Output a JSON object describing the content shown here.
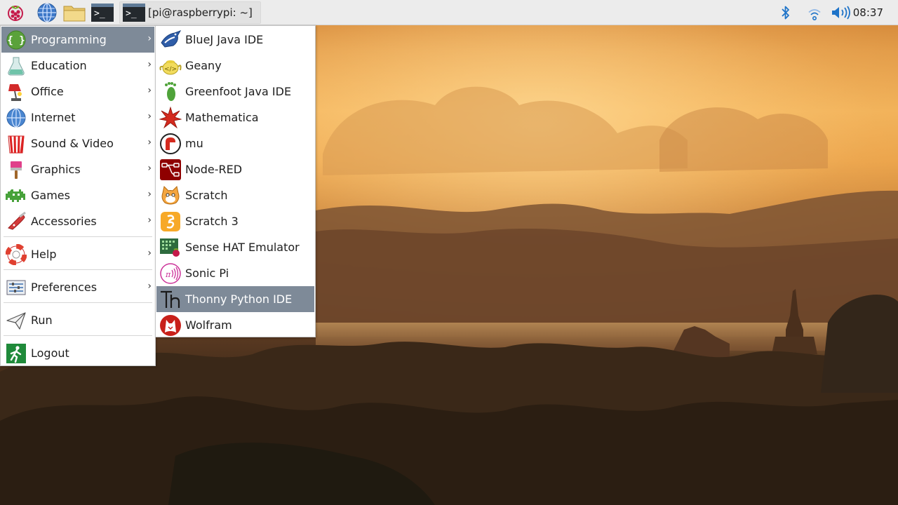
{
  "colors": {
    "taskbar_bg": "#ececec",
    "menu_bg": "#ffffff",
    "menu_selected_bg": "#7e8a98",
    "menu_selected_text": "#ffffff",
    "status_icon_blue": "#1e73c8"
  },
  "taskbar": {
    "launchers": [
      {
        "icon": "raspberry-pi-menu-icon"
      },
      {
        "icon": "web-browser-icon"
      },
      {
        "icon": "file-manager-icon"
      },
      {
        "icon": "terminal-icon"
      }
    ],
    "window_button": {
      "icon": "terminal-icon",
      "label": "[pi@raspberrypi: ~]"
    },
    "tray": {
      "bluetooth_icon": "bluetooth-icon",
      "wifi_icon": "wifi-icon",
      "volume_icon": "volume-icon",
      "clock": "08:37"
    }
  },
  "main_menu": {
    "items": [
      {
        "label": "Programming",
        "icon": "programming-icon",
        "has_submenu": true,
        "selected": true
      },
      {
        "label": "Education",
        "icon": "education-flask-icon",
        "has_submenu": true
      },
      {
        "label": "Office",
        "icon": "office-lamp-icon",
        "has_submenu": true
      },
      {
        "label": "Internet",
        "icon": "internet-globe-icon",
        "has_submenu": true
      },
      {
        "label": "Sound & Video",
        "icon": "sound-video-icon",
        "has_submenu": true
      },
      {
        "label": "Graphics",
        "icon": "graphics-brush-icon",
        "has_submenu": true
      },
      {
        "label": "Games",
        "icon": "games-invader-icon",
        "has_submenu": true
      },
      {
        "label": "Accessories",
        "icon": "accessories-knife-icon",
        "has_submenu": true
      },
      {
        "label": "Help",
        "icon": "help-lifebuoy-icon",
        "has_submenu": true
      },
      {
        "label": "Preferences",
        "icon": "preferences-icon",
        "has_submenu": true
      },
      {
        "label": "Run",
        "icon": "run-paper-plane-icon",
        "has_submenu": false
      },
      {
        "label": "Logout",
        "icon": "logout-exit-icon",
        "has_submenu": false
      }
    ],
    "arrow_glyph": "›"
  },
  "submenu": {
    "parent": "Programming",
    "items": [
      {
        "label": "BlueJ Java IDE",
        "icon": "bluej-bird-icon"
      },
      {
        "label": "Geany",
        "icon": "geany-teapot-icon"
      },
      {
        "label": "Greenfoot Java IDE",
        "icon": "greenfoot-footprint-icon"
      },
      {
        "label": "Mathematica",
        "icon": "mathematica-spiky-icon"
      },
      {
        "label": "mu",
        "icon": "mu-editor-icon"
      },
      {
        "label": "Node-RED",
        "icon": "node-red-icon"
      },
      {
        "label": "Scratch",
        "icon": "scratch-cat-icon"
      },
      {
        "label": "Scratch 3",
        "icon": "scratch3-icon"
      },
      {
        "label": "Sense HAT Emulator",
        "icon": "sense-hat-icon"
      },
      {
        "label": "Sonic Pi",
        "icon": "sonic-pi-icon"
      },
      {
        "label": "Thonny Python IDE",
        "icon": "thonny-icon",
        "selected": true
      },
      {
        "label": "Wolfram",
        "icon": "wolfram-wolf-icon"
      }
    ]
  }
}
